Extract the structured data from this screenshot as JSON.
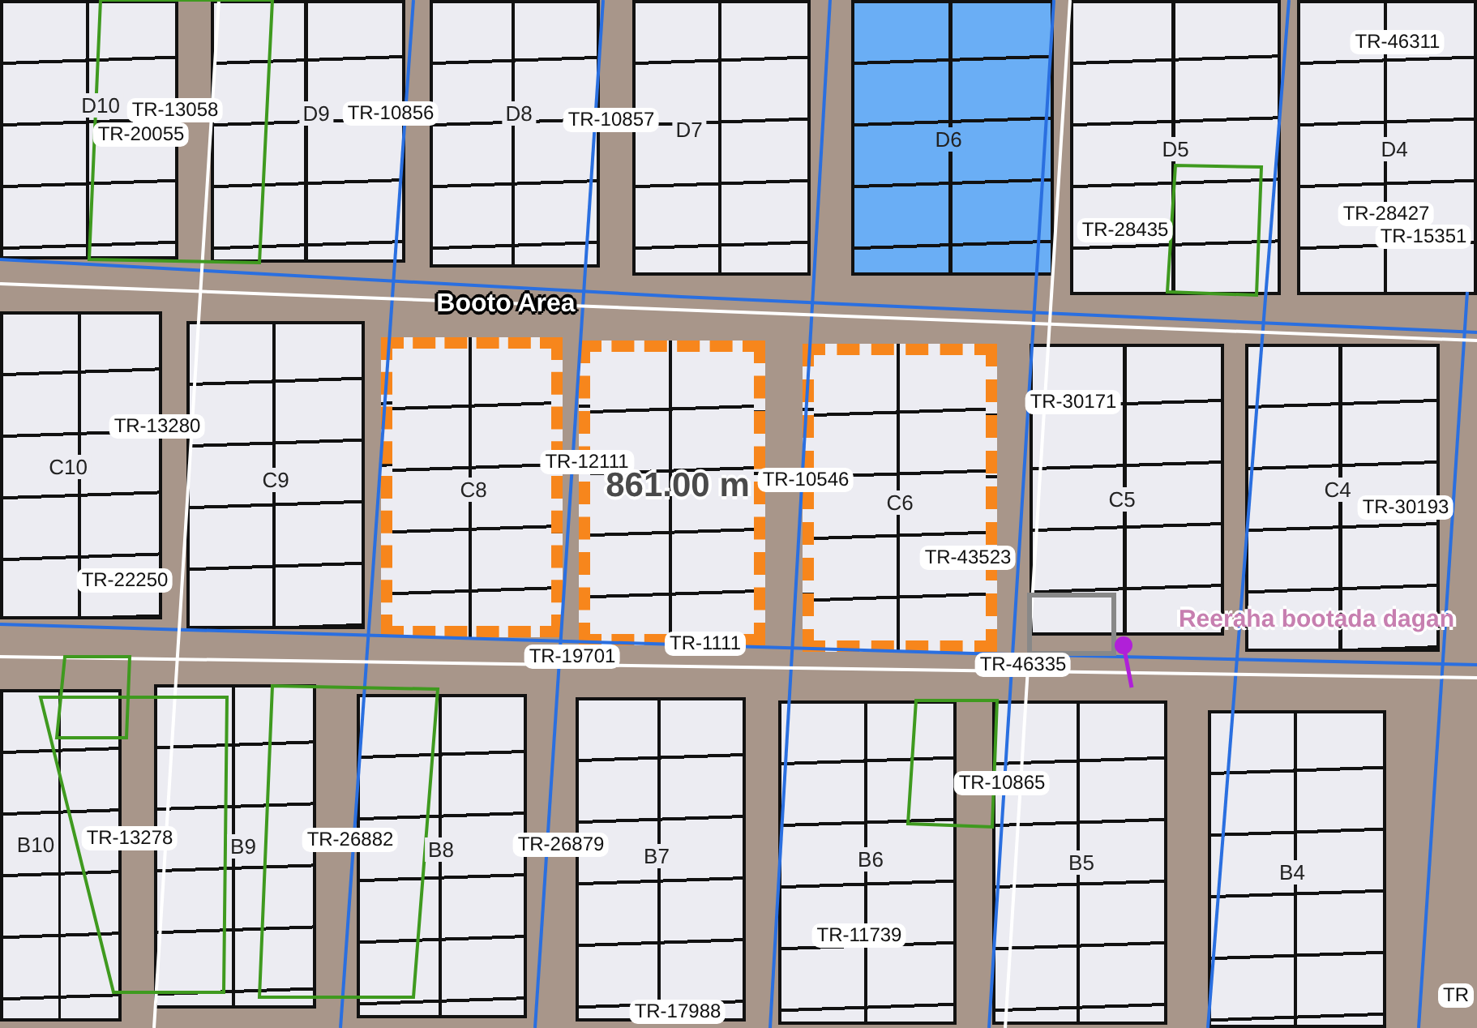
{
  "map": {
    "area_label": "Booto Area",
    "measurement": "861.00 m",
    "marker": {
      "label": "Reeraha bootada dagan"
    },
    "blocks": [
      {
        "label": "D10",
        "selected": false,
        "measured": false
      },
      {
        "label": "D9",
        "selected": false,
        "measured": false
      },
      {
        "label": "D8",
        "selected": false,
        "measured": false
      },
      {
        "label": "D7",
        "selected": false,
        "measured": false
      },
      {
        "label": "D6",
        "selected": true,
        "measured": false
      },
      {
        "label": "D5",
        "selected": false,
        "measured": false
      },
      {
        "label": "D4",
        "selected": false,
        "measured": false
      },
      {
        "label": "C10",
        "selected": false,
        "measured": false
      },
      {
        "label": "C9",
        "selected": false,
        "measured": false
      },
      {
        "label": "C8",
        "selected": false,
        "measured": true
      },
      {
        "selected": false,
        "measured": true
      },
      {
        "label": "C6",
        "selected": false,
        "measured": true
      },
      {
        "label": "C5",
        "selected": false,
        "measured": false
      },
      {
        "label": "C4",
        "selected": false,
        "measured": false
      },
      {
        "label": "B10",
        "selected": false,
        "measured": false
      },
      {
        "label": "B9",
        "selected": false,
        "measured": false
      },
      {
        "label": "B8",
        "selected": false,
        "measured": false
      },
      {
        "label": "B7",
        "selected": false,
        "measured": false
      },
      {
        "label": "B6",
        "selected": false,
        "measured": false
      },
      {
        "label": "B5",
        "selected": false,
        "measured": false
      },
      {
        "label": "B4",
        "selected": false,
        "measured": false
      }
    ],
    "parcel_labels": [
      "TR-13058",
      "TR-20055",
      "TR-10856",
      "TR-10857",
      "TR-46311",
      "TR-28435",
      "TR-28427",
      "TR-15351",
      "TR-13280",
      "TR-22250",
      "TR-12111",
      "TR-10546",
      "TR-30171",
      "TR-43523",
      "TR-30193",
      "TR-19701",
      "TR-1111",
      "TR-46335",
      "TR-13278",
      "TR-26882",
      "TR-26879",
      "TR-10865",
      "TR-11739",
      "TR-17988",
      "TR"
    ]
  }
}
